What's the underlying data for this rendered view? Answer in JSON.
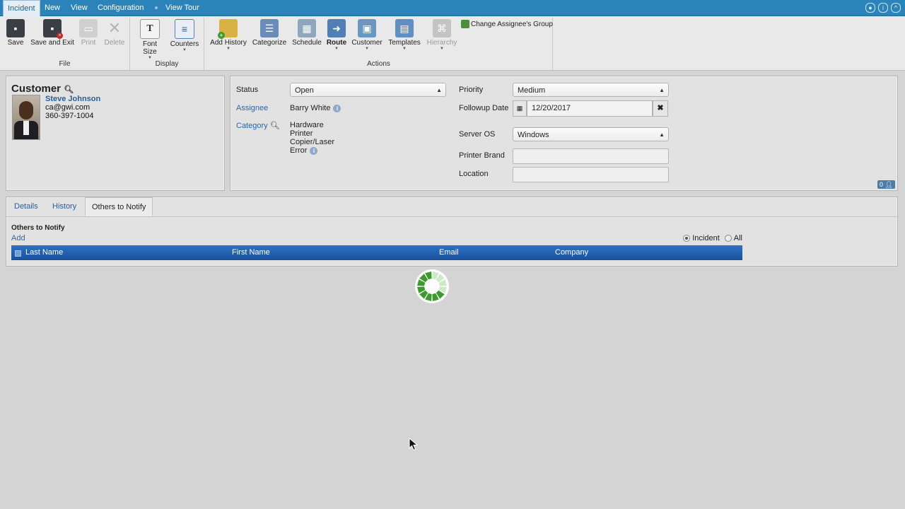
{
  "menubar": {
    "items": [
      "Incident",
      "New",
      "View",
      "Configuration"
    ],
    "view_tour": "View Tour"
  },
  "ribbon": {
    "file": {
      "title": "File",
      "buttons": [
        "Save",
        "Save and Exit",
        "Print",
        "Delete"
      ]
    },
    "display": {
      "title": "Display",
      "buttons": [
        "Font Size",
        "Counters"
      ]
    },
    "actions": {
      "title": "Actions",
      "buttons": [
        "Add History",
        "Categorize",
        "Schedule",
        "Route",
        "Customer",
        "Templates",
        "Hierarchy"
      ],
      "change_group": "Change Assignee's Group"
    }
  },
  "customer": {
    "title": "Customer",
    "name": "Steve Johnson",
    "email": "ca@gwi.com",
    "phone": "360-397-1004"
  },
  "incident": {
    "status_label": "Status",
    "status_value": "Open",
    "assignee_label": "Assignee",
    "assignee_value": "Barry White",
    "category_label": "Category",
    "category_path": [
      "Hardware",
      "Printer",
      "Copier/Laser",
      "Error"
    ],
    "priority_label": "Priority",
    "priority_value": "Medium",
    "followup_label": "Followup Date",
    "followup_value": "12/20/2017",
    "server_os_label": "Server OS",
    "server_os_value": "Windows",
    "printer_brand_label": "Printer Brand",
    "printer_brand_value": "",
    "location_label": "Location",
    "location_value": "",
    "counter_badge": "0"
  },
  "tabs": [
    "Details",
    "History",
    "Others to Notify"
  ],
  "notify": {
    "section_title": "Others to Notify",
    "add_label": "Add",
    "radio_incident": "Incident",
    "radio_all": "All",
    "columns": [
      "Last Name",
      "First Name",
      "Email",
      "Company"
    ]
  },
  "colors": {
    "menubar": "#2b84b9",
    "grid_header": "#1e5aa8",
    "spinner": "#3c9a2e"
  }
}
